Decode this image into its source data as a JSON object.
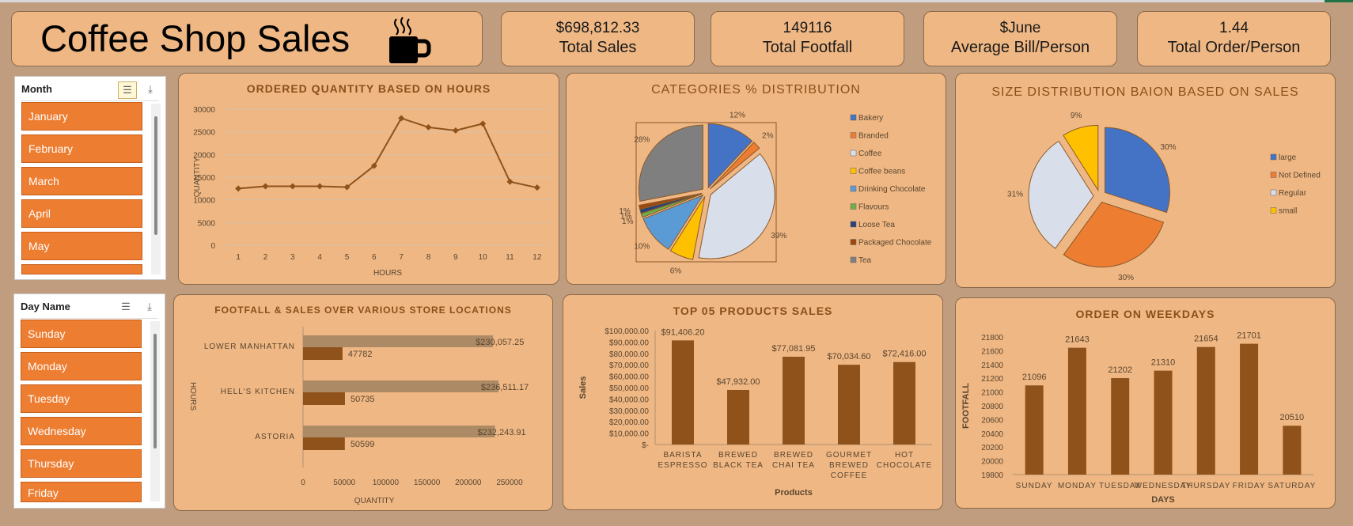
{
  "header": {
    "title": "Coffee Shop Sales"
  },
  "kpis": [
    {
      "value": "$698,812.33",
      "label": "Total Sales"
    },
    {
      "value": "149116",
      "label": "Total Footfall"
    },
    {
      "value": "$June",
      "label": "Average Bill/Person"
    },
    {
      "value": "1.44",
      "label": "Total Order/Person"
    }
  ],
  "slicers": {
    "month": {
      "header": "Month",
      "items": [
        "January",
        "February",
        "March",
        "April",
        "May"
      ]
    },
    "day": {
      "header": "Day Name",
      "items": [
        "Sunday",
        "Monday",
        "Tuesday",
        "Wednesday",
        "Thursday",
        "Friday"
      ]
    }
  },
  "colors": {
    "brown": "#8f521b",
    "tan": "#ad8a66",
    "card": "#efb783",
    "slicer_item": "#ed7d31"
  },
  "chart_data": [
    {
      "type": "line",
      "title": "ORDERED QUANTITY BASED ON HOURS",
      "xlabel": "HOURS",
      "ylabel": "QUANTITY",
      "x": [
        "1",
        "2",
        "3",
        "4",
        "5",
        "6",
        "7",
        "8",
        "9",
        "10",
        "11",
        "12"
      ],
      "values": [
        12500,
        13000,
        13000,
        13000,
        12800,
        17500,
        28000,
        26000,
        25300,
        26800,
        14000,
        12700
      ],
      "yticks": [
        "0",
        "5000",
        "10000",
        "15000",
        "20000",
        "25000",
        "30000"
      ],
      "ylim": [
        0,
        30000
      ],
      "grid": true
    },
    {
      "type": "pie",
      "title": "CATEGORIES % DISTRIBUTION",
      "legend_position": "right",
      "slices": [
        {
          "name": "Bakery",
          "value": 12,
          "label": "12%",
          "color": "#4472c4"
        },
        {
          "name": "Branded",
          "value": 2,
          "label": "2%",
          "color": "#ed7d31"
        },
        {
          "name": "Coffee",
          "value": 39,
          "label": "39%",
          "color": "#d9dfea"
        },
        {
          "name": "Coffee beans",
          "value": 6,
          "label": "6%",
          "color": "#ffc000"
        },
        {
          "name": "Drinking Chocolate",
          "value": 10,
          "label": "10%",
          "color": "#5b9bd5"
        },
        {
          "name": "Flavours",
          "value": 1,
          "label": "1%",
          "color": "#70ad47"
        },
        {
          "name": "Loose Tea",
          "value": 1,
          "label": "1%",
          "color": "#264478"
        },
        {
          "name": "Packaged Chocolate",
          "value": 1,
          "label": "1%",
          "color": "#9e480e"
        },
        {
          "name": "Tea",
          "value": 28,
          "label": "28%",
          "color": "#7f7f7f"
        }
      ]
    },
    {
      "type": "pie",
      "title": "SIZE DISTRIBUTION BAION BASED ON SALES",
      "legend_position": "right",
      "slices": [
        {
          "name": "large",
          "value": 30,
          "label": "30%",
          "color": "#4472c4"
        },
        {
          "name": "Not Defined",
          "value": 30,
          "label": "30%",
          "color": "#ed7d31"
        },
        {
          "name": "Regular",
          "value": 31,
          "label": "31%",
          "color": "#d9dfea"
        },
        {
          "name": "small",
          "value": 9,
          "label": "9%",
          "color": "#ffc000"
        }
      ]
    },
    {
      "type": "bar",
      "orientation": "horizontal",
      "title": "FOOTFALL & SALES OVER VARIOUS STORE LOCATIONS",
      "xlabel": "QUANTITY",
      "ylabel": "HOURS",
      "categories": [
        "LOWER MANHATTAN",
        "HELL'S KITCHEN",
        "ASTORIA"
      ],
      "series": [
        {
          "values": [
            230057.25,
            236511.17,
            232243.91
          ],
          "labels": [
            "$230,057.25",
            "$236,511.17",
            "$232,243.91"
          ]
        },
        {
          "values": [
            47782,
            50735,
            50599
          ],
          "labels": [
            "47782",
            "50735",
            "50599"
          ]
        }
      ],
      "xticks": [
        "0",
        "50000",
        "100000",
        "150000",
        "200000",
        "250000"
      ],
      "xlim": [
        0,
        250000
      ]
    },
    {
      "type": "bar",
      "title": "TOP 05 PRODUCTS SALES",
      "xlabel": "Products",
      "ylabel": "Sales",
      "categories": [
        [
          "BARISTA",
          "ESPRESSO"
        ],
        [
          "BREWED",
          "BLACK TEA"
        ],
        [
          "BREWED",
          "CHAI TEA"
        ],
        [
          "GOURMET",
          "BREWED",
          "COFFEE"
        ],
        [
          "HOT",
          "CHOCOLATE"
        ]
      ],
      "values": [
        91406.2,
        47932.0,
        77081.95,
        70034.6,
        72416.0
      ],
      "labels": [
        "$91,406.20",
        "$47,932.00",
        "$77,081.95",
        "$70,034.60",
        "$72,416.00"
      ],
      "yticks": [
        "$-",
        "$10,000.00",
        "$20,000.00",
        "$30,000.00",
        "$40,000.00",
        "$50,000.00",
        "$60,000.00",
        "$70,000.00",
        "$80,000.00",
        "$90,000.00",
        "$100,000.00"
      ],
      "ylim": [
        0,
        100000
      ]
    },
    {
      "type": "bar",
      "title": "ORDER ON WEEKDAYS",
      "xlabel": "DAYS",
      "ylabel": "FOOTFALL",
      "categories": [
        "SUNDAY",
        "MONDAY",
        "TUESDAY",
        "WEDNESDAY",
        "THURSDAY",
        "FRIDAY",
        "SATURDAY"
      ],
      "values": [
        21096,
        21643,
        21202,
        21310,
        21654,
        21701,
        20510
      ],
      "yticks": [
        "19800",
        "20000",
        "20200",
        "20400",
        "20600",
        "20800",
        "21000",
        "21200",
        "21400",
        "21600",
        "21800"
      ],
      "ylim": [
        19800,
        21800
      ]
    }
  ]
}
